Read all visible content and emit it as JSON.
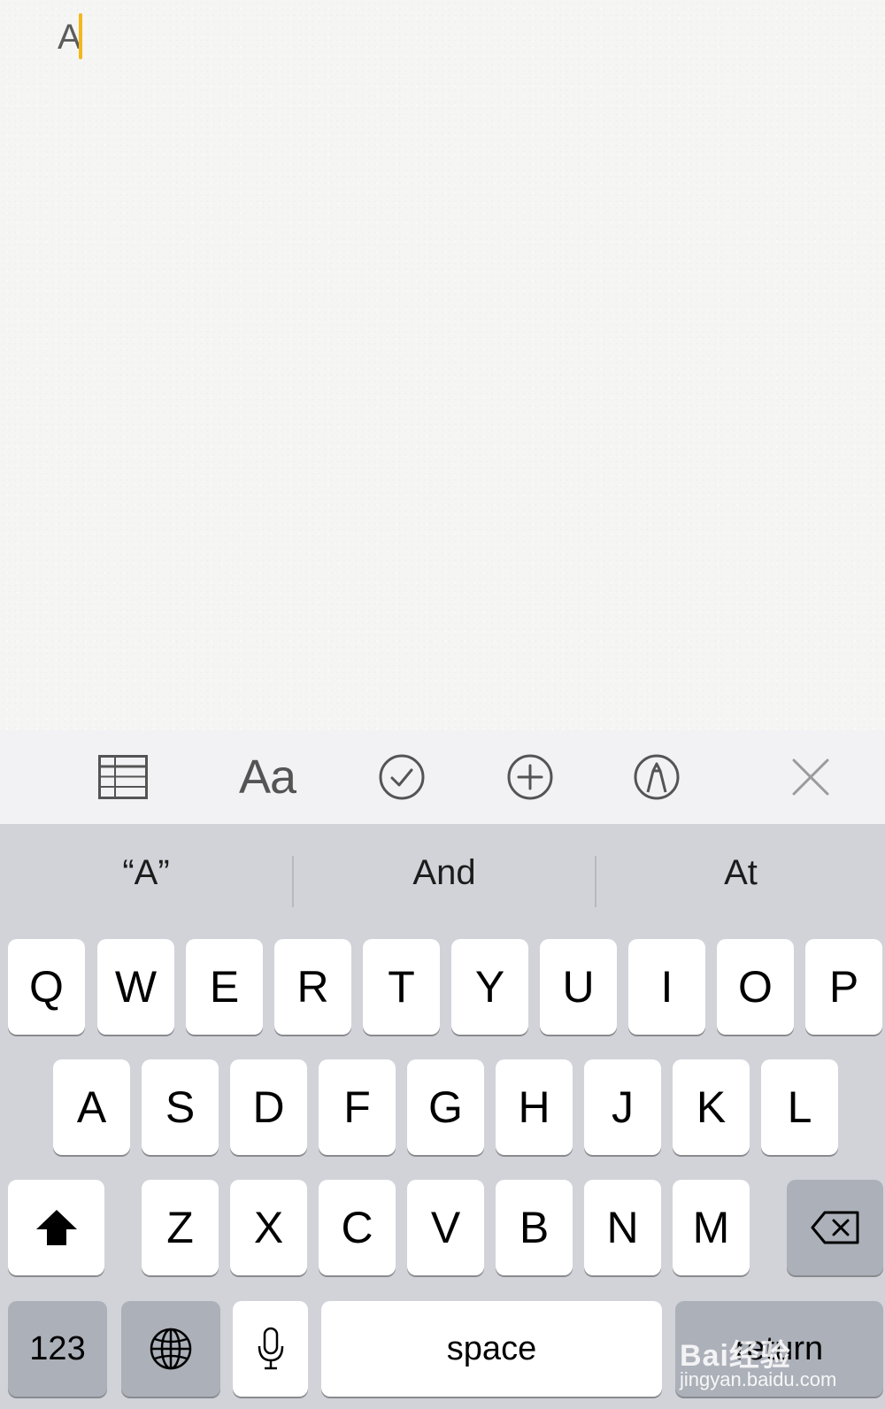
{
  "note": {
    "text": "A"
  },
  "toolbar": {
    "items": [
      {
        "icon": "table-icon"
      },
      {
        "label": "Aa",
        "icon": "format-icon"
      },
      {
        "icon": "checklist-icon"
      },
      {
        "icon": "add-icon"
      },
      {
        "icon": "markup-icon"
      },
      {
        "icon": "close-icon"
      }
    ]
  },
  "suggestions": [
    "“A”",
    "And",
    "At"
  ],
  "keyboard": {
    "row1": [
      "Q",
      "W",
      "E",
      "R",
      "T",
      "Y",
      "U",
      "I",
      "O",
      "P"
    ],
    "row2": [
      "A",
      "S",
      "D",
      "F",
      "G",
      "H",
      "J",
      "K",
      "L"
    ],
    "row3": [
      "Z",
      "X",
      "C",
      "V",
      "B",
      "N",
      "M"
    ],
    "shift_icon": "shift-icon",
    "delete_icon": "delete-icon",
    "numbers_label": "123",
    "globe_icon": "globe-icon",
    "mic_icon": "microphone-icon",
    "space_label": "space",
    "return_label": "return"
  },
  "watermark": {
    "brand": "Bai经验",
    "url": "jingyan.baidu.com"
  },
  "colors": {
    "caret": "#f1b81b",
    "keyboard_bg": "#d1d3d9",
    "key_bg": "#ffffff",
    "function_key_bg": "#acb0b9"
  }
}
